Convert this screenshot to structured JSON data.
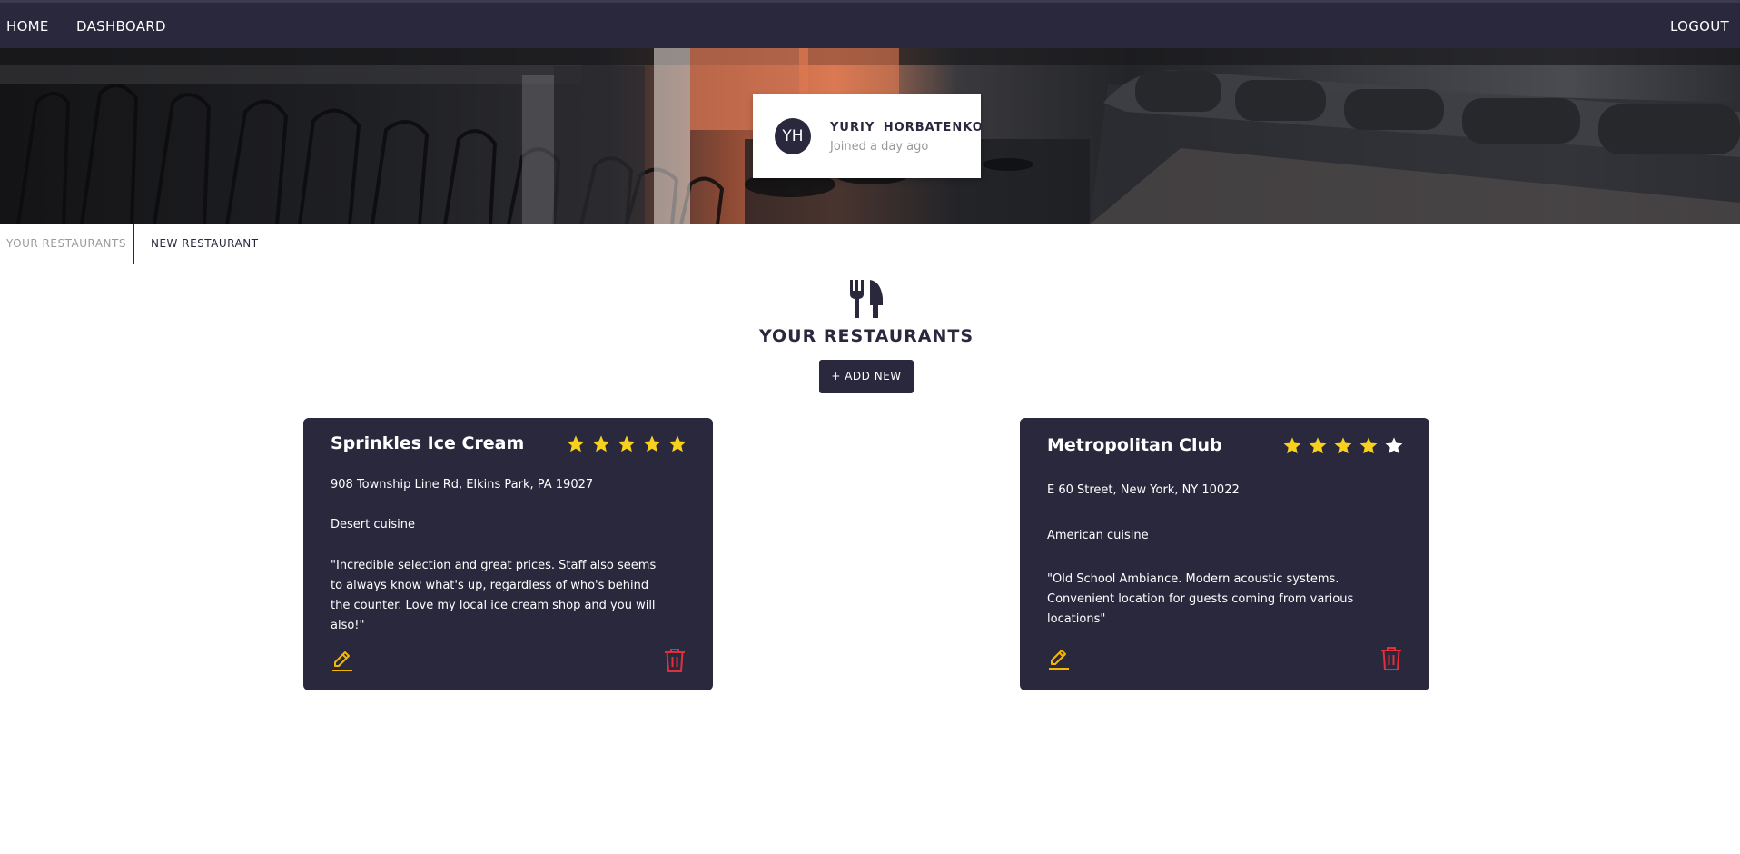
{
  "nav": {
    "home": "HOME",
    "dashboard": "DASHBOARD",
    "logout": "LOGOUT"
  },
  "profile": {
    "initials": "YH",
    "name": "YURIY HORBATENKO",
    "joined": "Joined a day ago"
  },
  "tabs": {
    "your_restaurants": "YOUR RESTAURANTS",
    "new_restaurant": "NEW RESTAURANT"
  },
  "section": {
    "icon": "utensils-icon",
    "title": "YOUR RESTAURANTS",
    "add_button": "+ ADD NEW"
  },
  "restaurants": [
    {
      "name": "Sprinkles Ice Cream",
      "rating": 5,
      "address": "908 Township Line Rd, Elkins Park, PA 19027",
      "cuisine": "Desert cuisine",
      "review": "\"Incredible selection and great prices. Staff also seems to always know what's up, regardless of who's behind the counter. Love my local ice cream shop and you will also!\""
    },
    {
      "name": "Metropolitan Club",
      "rating": 4,
      "address": "E 60 Street, New York, NY 10022",
      "cuisine": "American cuisine",
      "review": "\"Old School Ambiance. Modern acoustic systems. Convenient location for guests coming from various locations\""
    }
  ],
  "colors": {
    "primary": "#2a283d",
    "star_filled": "#f7d11e",
    "star_empty": "#ffffff",
    "edit": "#f5b800",
    "delete": "#e0303c"
  }
}
